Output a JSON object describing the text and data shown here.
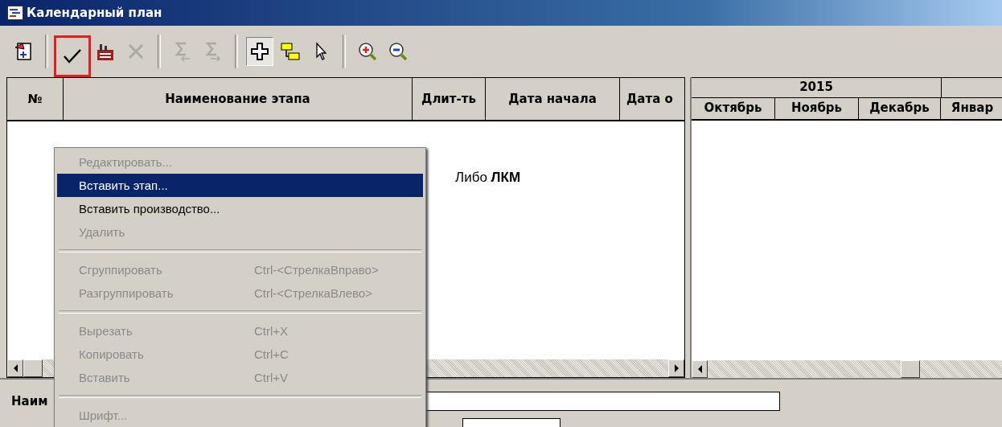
{
  "window": {
    "title": "Календарный план"
  },
  "toolbar": [
    [
      {
        "kind": "calendar",
        "disabled": false,
        "pressed": false,
        "highlighted": false
      }
    ],
    [
      {
        "kind": "check",
        "disabled": false,
        "pressed": false,
        "highlighted": true
      },
      {
        "kind": "factory",
        "disabled": false,
        "pressed": false,
        "highlighted": false
      },
      {
        "kind": "delete",
        "disabled": true,
        "pressed": false,
        "highlighted": false
      }
    ],
    [
      {
        "kind": "sum_left",
        "disabled": true,
        "pressed": false,
        "highlighted": false
      },
      {
        "kind": "sum_right",
        "disabled": true,
        "pressed": false,
        "highlighted": false
      }
    ],
    [
      {
        "kind": "add",
        "disabled": false,
        "pressed": true,
        "highlighted": false
      },
      {
        "kind": "link",
        "disabled": false,
        "pressed": false,
        "highlighted": false
      },
      {
        "kind": "pointer",
        "disabled": false,
        "pressed": false,
        "highlighted": false
      }
    ],
    [
      {
        "kind": "zoom_in",
        "disabled": false,
        "pressed": false,
        "highlighted": false
      },
      {
        "kind": "zoom_out",
        "disabled": false,
        "pressed": false,
        "highlighted": false
      }
    ]
  ],
  "table": {
    "columns": [
      "№",
      "Наименование этапа",
      "Длит-ть",
      "Дата начала",
      "Дата о"
    ]
  },
  "gantt": {
    "year": "2015",
    "months": [
      "Октябрь",
      "Ноябрь",
      "Декабрь",
      "Январ"
    ]
  },
  "note": "Либо **ЛКМ**",
  "context_menu": [
    {
      "kind": "item",
      "label": "Редактировать...",
      "disabled": true,
      "selected": false
    },
    {
      "kind": "item",
      "label": "Вставить этап...",
      "disabled": false,
      "selected": true
    },
    {
      "kind": "item",
      "label": "Вставить производство...",
      "disabled": false,
      "selected": false
    },
    {
      "kind": "item",
      "label": "Удалить",
      "disabled": true,
      "selected": false
    },
    {
      "kind": "separator"
    },
    {
      "kind": "item",
      "label": "Сгруппировать",
      "shortcut": "Ctrl-<СтрелкаВправо>",
      "disabled": true,
      "selected": false
    },
    {
      "kind": "item",
      "label": "Разгруппировать",
      "shortcut": "Ctrl-<СтрелкаВлево>",
      "disabled": true,
      "selected": false
    },
    {
      "kind": "separator"
    },
    {
      "kind": "item",
      "label": "Вырезать",
      "shortcut": "Ctrl+X",
      "disabled": true,
      "selected": false
    },
    {
      "kind": "item",
      "label": "Копировать",
      "shortcut": "Ctrl+C",
      "disabled": true,
      "selected": false
    },
    {
      "kind": "item",
      "label": "Вставить",
      "shortcut": "Ctrl+V",
      "disabled": true,
      "selected": false
    },
    {
      "kind": "separator"
    },
    {
      "kind": "item",
      "label": "Шрифт...",
      "disabled": true,
      "selected": false
    }
  ],
  "bottom_panel": {
    "label": "Наим"
  }
}
